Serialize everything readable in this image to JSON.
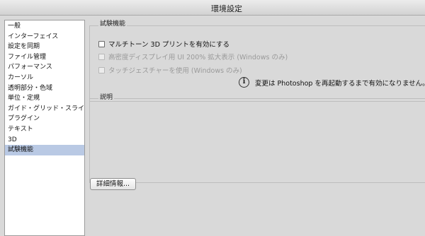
{
  "window": {
    "title": "環境設定"
  },
  "sidebar": {
    "items": [
      {
        "label": "一般",
        "selected": false
      },
      {
        "label": "インターフェイス",
        "selected": false
      },
      {
        "label": "設定を同期",
        "selected": false
      },
      {
        "label": "ファイル管理",
        "selected": false
      },
      {
        "label": "パフォーマンス",
        "selected": false
      },
      {
        "label": "カーソル",
        "selected": false
      },
      {
        "label": "透明部分・色域",
        "selected": false
      },
      {
        "label": "単位・定規",
        "selected": false
      },
      {
        "label": "ガイド・グリッド・スライス",
        "selected": false
      },
      {
        "label": "プラグイン",
        "selected": false
      },
      {
        "label": "テキスト",
        "selected": false
      },
      {
        "label": "3D",
        "selected": false
      },
      {
        "label": "試験機能",
        "selected": true
      }
    ]
  },
  "experimental": {
    "group_label": "試験機能",
    "options": [
      {
        "label": "マルチトーン 3D プリントを有効にする",
        "checked": false,
        "enabled": true
      },
      {
        "label": "高密度ディスプレイ用 UI 200% 拡大表示 (Windows のみ)",
        "checked": false,
        "enabled": false
      },
      {
        "label": "タッチジェスチャーを使用 (Windows のみ)",
        "checked": false,
        "enabled": false
      }
    ],
    "info_icon": "info-circle-icon",
    "info_text": "変更は Photoshop を再起動するまで有効になりません。"
  },
  "description": {
    "group_label": "説明",
    "text": ""
  },
  "details_button": {
    "label": "詳細情報..."
  }
}
